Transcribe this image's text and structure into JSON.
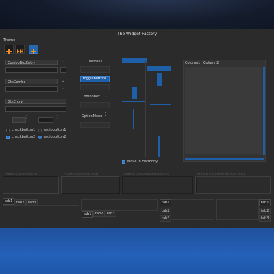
{
  "window": {
    "title": "The Widget Factory"
  },
  "toolbar": {
    "section_label": "Theme",
    "buttons": [
      {
        "icon": "add-icon"
      },
      {
        "icon": "media-next-icon"
      },
      {
        "icon": "add-icon"
      }
    ]
  },
  "left": {
    "combo_entry_1": "ComboBoxEntry",
    "gtk_combo": "GtkCombo",
    "gtk_entry": "GtkEntry",
    "spin_value": "1",
    "checkbuttons": [
      "checkbutton1",
      "checkbutton2"
    ],
    "radiobuttons": [
      "radiobutton1",
      "radiobutton2"
    ]
  },
  "middle": {
    "button1": "button1",
    "togglebutton1": "togglebutton1",
    "combobox": "ComboBox",
    "optionmenu": "OptionMenu"
  },
  "scroll": {
    "move_in_harmony": "Move In Harmony"
  },
  "tree": {
    "columns": [
      "Column1",
      "Column2"
    ]
  },
  "frames": [
    "Frame (Shadow in)",
    "Frame (Shadow out)",
    "Frame (Shadow etched in)",
    "Frame (Shadow etched out)"
  ],
  "notebooks": {
    "top_tabs": [
      "tab1",
      "tab2",
      "tab3"
    ],
    "bottom_tabs": [
      "tab1",
      "tab2",
      "tab3"
    ],
    "left_tabs": [
      "tab1",
      "tab2",
      "tab3"
    ],
    "right_tabs": [
      "tab1",
      "tab2",
      "tab3"
    ]
  },
  "colors": {
    "accent": "#1f5fa8",
    "window_bg": "#2b2b2b",
    "desktop": "#2561b8"
  }
}
